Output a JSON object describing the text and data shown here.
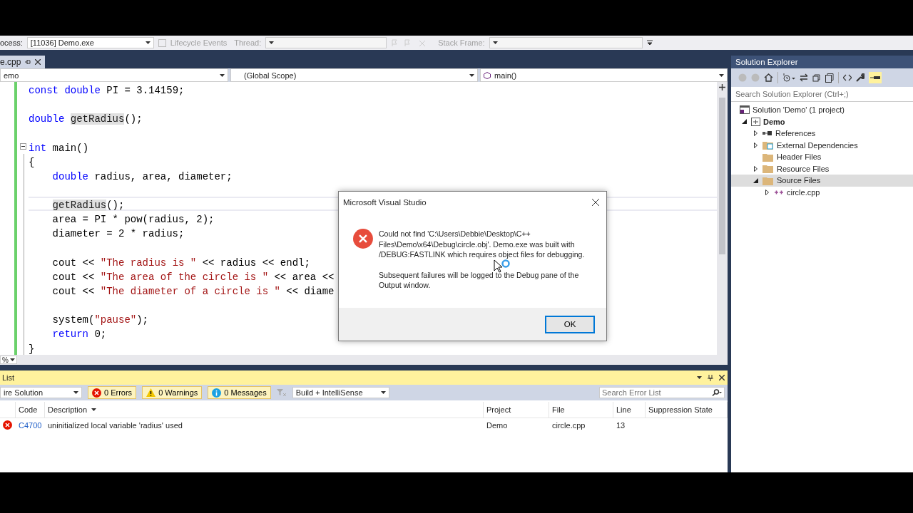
{
  "debug_toolbar": {
    "process_label": "ocess:",
    "process": "[11036] Demo.exe",
    "lifecycle": "Lifecycle Events",
    "thread_label": "Thread:",
    "stack_label": "Stack Frame:"
  },
  "document_tab": {
    "label": "e.cpp",
    "selected": true
  },
  "nav_bar": {
    "project": "emo",
    "scope": "(Global Scope)",
    "member": "main()"
  },
  "code_lines": [
    {
      "tokens": [
        {
          "kind": "keyword",
          "text": "const double"
        },
        {
          "kind": "plain",
          "text": " PI = 3.14159;"
        }
      ]
    },
    {
      "blank": true
    },
    {
      "tokens": [
        {
          "kind": "keyword",
          "text": "double "
        },
        {
          "kind": "reference",
          "text": "getRadius"
        },
        {
          "kind": "plain",
          "text": "();"
        }
      ]
    },
    {
      "blank": true
    },
    {
      "fold_expanded": true,
      "tokens": [
        {
          "kind": "keyword",
          "text": "int"
        },
        {
          "kind": "plain",
          "text": " main()"
        }
      ]
    },
    {
      "tokens": [
        {
          "kind": "plain",
          "text": "{"
        }
      ]
    },
    {
      "indented": true,
      "tokens": [
        {
          "kind": "keyword",
          "text": "double"
        },
        {
          "kind": "plain",
          "text": " radius, area, diameter;"
        }
      ]
    },
    {
      "blank": true
    },
    {
      "indented": true,
      "current": true,
      "tokens": [
        {
          "kind": "reference",
          "text": "getRadius"
        },
        {
          "kind": "plain",
          "text": "();"
        }
      ]
    },
    {
      "indented": true,
      "tokens": [
        {
          "kind": "plain",
          "text": "area = PI * pow(radius, 2);"
        }
      ]
    },
    {
      "indented": true,
      "tokens": [
        {
          "kind": "plain",
          "text": "diameter = 2 * radius;"
        }
      ]
    },
    {
      "blank": true
    },
    {
      "indented": true,
      "tokens": [
        {
          "kind": "plain",
          "text": "cout << "
        },
        {
          "kind": "string",
          "text": "\"The radius is \""
        },
        {
          "kind": "plain",
          "text": " << radius << endl;"
        }
      ]
    },
    {
      "indented": true,
      "tokens": [
        {
          "kind": "plain",
          "text": "cout << "
        },
        {
          "kind": "string",
          "text": "\"The area of the circle is \""
        },
        {
          "kind": "plain",
          "text": " << area <<"
        }
      ]
    },
    {
      "indented": true,
      "tokens": [
        {
          "kind": "plain",
          "text": "cout << "
        },
        {
          "kind": "string",
          "text": "\"The diameter of a circle is \""
        },
        {
          "kind": "plain",
          "text": " << diame"
        }
      ]
    },
    {
      "blank": true
    },
    {
      "indented": true,
      "tokens": [
        {
          "kind": "plain",
          "text": "system("
        },
        {
          "kind": "string",
          "text": "\"pause\""
        },
        {
          "kind": "plain",
          "text": ");"
        }
      ]
    },
    {
      "indented": true,
      "tokens": [
        {
          "kind": "keyword",
          "text": "return"
        },
        {
          "kind": "plain",
          "text": " 0;"
        }
      ]
    },
    {
      "tokens": [
        {
          "kind": "plain",
          "text": "}"
        }
      ]
    }
  ],
  "zoom_level": "%",
  "error_list": {
    "title": "List",
    "scope": "ire Solution",
    "filters": [
      {
        "kind": "error",
        "label": "0 Errors",
        "on": true
      },
      {
        "kind": "warning",
        "label": "0 Warnings",
        "on": true
      },
      {
        "kind": "message",
        "label": "0 Messages",
        "on": true
      }
    ],
    "build_filter": "Build + IntelliSense",
    "search": {
      "placeholder": "Search Error List"
    },
    "columns": [
      "Code",
      "Description",
      "Project",
      "File",
      "Line",
      "Suppression State"
    ],
    "rows": [
      {
        "code": "C4700",
        "description": "uninitialized local variable 'radius' used",
        "project": "Demo",
        "file": "circle.cpp",
        "line": "13"
      }
    ]
  },
  "solution_explorer": {
    "title": "Solution Explorer",
    "search": {
      "placeholder": "Search Solution Explorer (Ctrl+;)"
    },
    "tree": [
      {
        "kind": "solution",
        "label": "Solution 'Demo' (1 project)",
        "selected": false,
        "children": [
          {
            "kind": "project",
            "label": "Demo",
            "expanded": true,
            "selected": false,
            "children": [
              {
                "kind": "references",
                "label": "References",
                "expanded": false,
                "selected": false
              },
              {
                "kind": "dependencies",
                "label": "External Dependencies",
                "expanded": false,
                "selected": false
              },
              {
                "kind": "folder",
                "label": "Header Files",
                "selected": false
              },
              {
                "kind": "folder",
                "label": "Resource Files",
                "expanded": false,
                "selected": false
              },
              {
                "kind": "folder",
                "label": "Source Files",
                "expanded": true,
                "selected": true,
                "children": [
                  {
                    "kind": "cpp",
                    "label": "circle.cpp",
                    "expanded": false,
                    "selected": false
                  }
                ]
              }
            ]
          }
        ]
      }
    ]
  },
  "dialog": {
    "title": "Microsoft Visual Studio",
    "message": "Could not find 'C:\\Users\\Debbie\\Desktop\\C++ Files\\Demo\\x64\\Debug\\circle.obj'. Demo.exe was built with /DEBUG:FASTLINK which requires object files for debugging.",
    "detail": "Subsequent failures will be logged to the Debug pane of the Output window.",
    "buttons": [
      "OK"
    ]
  }
}
